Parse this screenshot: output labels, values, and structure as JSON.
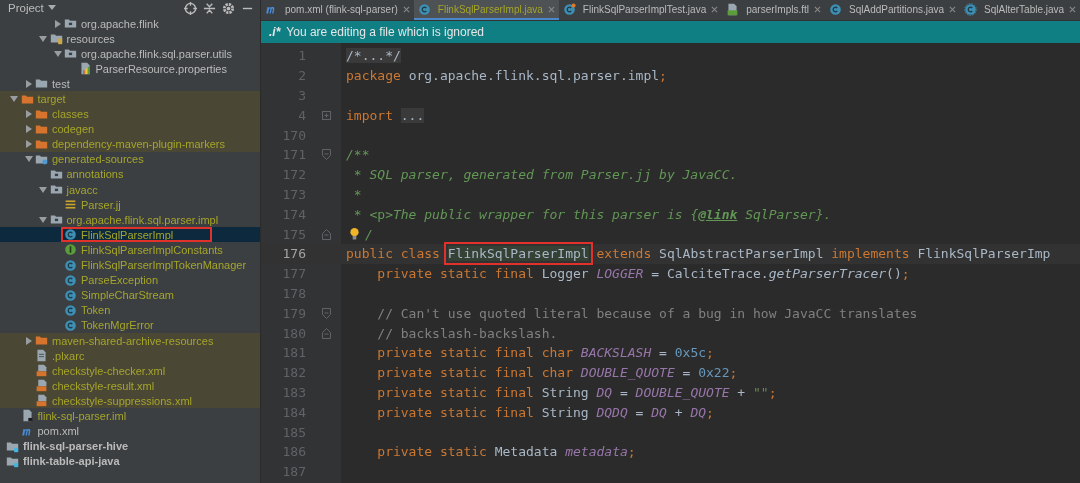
{
  "project_panel": {
    "title": "Project"
  },
  "tree": [
    {
      "children": [
        {
          "children": [
            {
              "children": [
                {
                  "children": [
                    {
                      "label": "org.apache.flink",
                      "kind": "package",
                      "expanded": false,
                      "ignored": false,
                      "excluded": false,
                      "selected": false
                    }
                  ]
                },
                {
                  "label": "resources",
                  "kind": "resources",
                  "expanded": true,
                  "ignored": false,
                  "excluded": false,
                  "selected": false,
                  "children": [
                    {
                      "label": "org.apache.flink.sql.parser.utils",
                      "kind": "package",
                      "expanded": true,
                      "ignored": false,
                      "excluded": false,
                      "selected": false,
                      "children": [
                        {
                          "label": "ParserResource.properties",
                          "kind": "properties",
                          "ignored": false,
                          "excluded": false,
                          "selected": false
                        }
                      ]
                    }
                  ]
                }
              ]
            },
            {
              "label": "test",
              "kind": "folder",
              "expanded": false,
              "ignored": false,
              "excluded": false,
              "selected": false
            }
          ]
        },
        {
          "label": "target",
          "kind": "excluded-folder",
          "expanded": true,
          "ignored": true,
          "excluded": true,
          "selected": false,
          "children": [
            {
              "label": "classes",
              "kind": "excluded-folder",
              "expanded": false,
              "ignored": true,
              "excluded": true,
              "selected": false
            },
            {
              "label": "codegen",
              "kind": "excluded-folder",
              "expanded": false,
              "ignored": true,
              "excluded": true,
              "selected": false
            },
            {
              "label": "dependency-maven-plugin-markers",
              "kind": "excluded-folder",
              "expanded": false,
              "ignored": true,
              "excluded": true,
              "selected": false
            },
            {
              "label": "generated-sources",
              "kind": "source-folder",
              "expanded": true,
              "ignored": true,
              "excluded": false,
              "selected": false,
              "children": [
                {
                  "label": "annotations",
                  "kind": "package",
                  "ignored": true,
                  "excluded": false,
                  "selected": false
                },
                {
                  "label": "javacc",
                  "kind": "package",
                  "expanded": true,
                  "ignored": true,
                  "excluded": false,
                  "selected": false,
                  "children": [
                    {
                      "label": "Parser.jj",
                      "kind": "grammar",
                      "ignored": true,
                      "excluded": false,
                      "selected": false
                    }
                  ]
                },
                {
                  "label": "org.apache.flink.sql.parser.impl",
                  "kind": "package",
                  "expanded": true,
                  "ignored": true,
                  "excluded": false,
                  "selected": false,
                  "children": [
                    {
                      "label": "FlinkSqlParserImpl",
                      "kind": "class",
                      "ignored": true,
                      "excluded": false,
                      "selected": true,
                      "highlighted": true
                    },
                    {
                      "label": "FlinkSqlParserImplConstants",
                      "kind": "interface",
                      "ignored": true,
                      "excluded": false,
                      "selected": false
                    },
                    {
                      "label": "FlinkSqlParserImplTokenManager",
                      "kind": "class",
                      "ignored": true,
                      "excluded": false,
                      "selected": false
                    },
                    {
                      "label": "ParseException",
                      "kind": "class",
                      "ignored": true,
                      "excluded": false,
                      "selected": false
                    },
                    {
                      "label": "SimpleCharStream",
                      "kind": "class",
                      "ignored": true,
                      "excluded": false,
                      "selected": false
                    },
                    {
                      "label": "Token",
                      "kind": "class",
                      "ignored": true,
                      "excluded": false,
                      "selected": false
                    },
                    {
                      "label": "TokenMgrError",
                      "kind": "class",
                      "ignored": true,
                      "excluded": false,
                      "selected": false
                    }
                  ]
                }
              ]
            },
            {
              "label": "maven-shared-archive-resources",
              "kind": "excluded-folder",
              "expanded": false,
              "ignored": true,
              "excluded": true,
              "selected": false
            },
            {
              "label": ".plxarc",
              "kind": "file",
              "ignored": true,
              "excluded": true,
              "selected": false
            },
            {
              "label": "checkstyle-checker.xml",
              "kind": "xml",
              "ignored": true,
              "excluded": true,
              "selected": false
            },
            {
              "label": "checkstyle-result.xml",
              "kind": "xml",
              "ignored": true,
              "excluded": true,
              "selected": false
            },
            {
              "label": "checkstyle-suppressions.xml",
              "kind": "xml",
              "ignored": true,
              "excluded": true,
              "selected": false
            }
          ]
        },
        {
          "label": "flink-sql-parser.iml",
          "kind": "iml",
          "ignored": true,
          "excluded": false,
          "selected": false
        },
        {
          "label": "pom.xml",
          "kind": "maven",
          "ignored": false,
          "excluded": false,
          "selected": false
        }
      ]
    },
    {
      "label": "flink-sql-parser-hive",
      "kind": "module",
      "ignored": false,
      "excluded": false,
      "selected": false
    },
    {
      "label": "flink-table-api-java",
      "kind": "module",
      "ignored": false,
      "excluded": false,
      "selected": false
    }
  ],
  "tabs": [
    {
      "label": "pom.xml (flink-sql-parser)",
      "kind": "maven",
      "selected": false,
      "ignored": false
    },
    {
      "label": "FlinkSqlParserImpl.java",
      "kind": "class",
      "selected": true,
      "ignored": true
    },
    {
      "label": "FlinkSqlParserImplTest.java",
      "kind": "test-class",
      "selected": false,
      "ignored": false
    },
    {
      "label": "parserImpls.ftl",
      "kind": "template",
      "selected": false,
      "ignored": false
    },
    {
      "label": "SqlAddPartitions.java",
      "kind": "class",
      "selected": false,
      "ignored": false
    },
    {
      "label": "SqlAlterTable.java",
      "kind": "abstract-class",
      "selected": false,
      "ignored": false
    }
  ],
  "banner": {
    "icon_text": ".i*",
    "message": "You are editing a file which is ignored"
  },
  "code": [
    {
      "number": "1",
      "current": false,
      "kind": "plain",
      "segments": [
        {
          "kind": "folded",
          "text": "/*...*/"
        }
      ]
    },
    {
      "number": "2",
      "current": false,
      "kind": "plain",
      "segments": [
        {
          "kind": "kw",
          "text": "package "
        },
        {
          "kind": "plain",
          "text": "org.apache.flink.sql.parser.impl"
        },
        {
          "kind": "kw",
          "text": ";"
        }
      ]
    },
    {
      "number": "3",
      "current": false,
      "kind": "plain"
    },
    {
      "number": "4",
      "current": false,
      "kind": "fold-collapsed",
      "segments": [
        {
          "kind": "kw",
          "text": "import "
        },
        {
          "kind": "folded",
          "text": "..."
        }
      ]
    },
    {
      "number": "170",
      "current": false,
      "kind": "plain"
    },
    {
      "number": "171",
      "current": false,
      "kind": "fold-start",
      "segments": [
        {
          "kind": "doc",
          "text": "/**"
        }
      ]
    },
    {
      "number": "172",
      "current": false,
      "kind": "plain",
      "segments": [
        {
          "kind": "doc",
          "text": " * SQL parser, generated from Parser.jj by JavaCC."
        }
      ]
    },
    {
      "number": "173",
      "current": false,
      "kind": "plain",
      "segments": [
        {
          "kind": "doc",
          "text": " *"
        }
      ]
    },
    {
      "number": "174",
      "current": false,
      "kind": "plain",
      "segments": [
        {
          "kind": "doc",
          "text": " * "
        },
        {
          "kind": "doctag",
          "text": "<p>"
        },
        {
          "kind": "doc",
          "text": "The public wrapper for this parser is {"
        },
        {
          "kind": "doclink",
          "text": "@link"
        },
        {
          "kind": "doc",
          "text": " SqlParser}."
        }
      ]
    },
    {
      "number": "175",
      "current": false,
      "kind": "fold-end",
      "bulb": true,
      "segments": [
        {
          "kind": "doc",
          "text": "/"
        }
      ]
    },
    {
      "number": "176",
      "current": true,
      "kind": "plain",
      "segments": [
        {
          "kind": "kw",
          "text": "public class "
        },
        {
          "kind": "boxed",
          "text": "FlinkSqlParserImpl"
        },
        {
          "kind": "kw",
          "text": " extends "
        },
        {
          "kind": "plain",
          "text": "SqlAbstractParserImpl "
        },
        {
          "kind": "kw",
          "text": "implements "
        },
        {
          "kind": "plain",
          "text": "FlinkSqlParserImp"
        }
      ]
    },
    {
      "number": "177",
      "current": false,
      "kind": "plain",
      "segments": [
        {
          "kind": "kw",
          "text": "    private static final "
        },
        {
          "kind": "plain",
          "text": "Logger "
        },
        {
          "kind": "field",
          "text": "LOGGER"
        },
        {
          "kind": "plain",
          "text": " = CalciteTrace."
        },
        {
          "kind": "call",
          "text": "getParserTracer"
        },
        {
          "kind": "plain",
          "text": "()"
        },
        {
          "kind": "kw",
          "text": ";"
        }
      ]
    },
    {
      "number": "178",
      "current": false,
      "kind": "plain"
    },
    {
      "number": "179",
      "current": false,
      "kind": "fold-start",
      "segments": [
        {
          "kind": "comment",
          "text": "    // Can't use quoted literal because of a bug in how JavaCC translates"
        }
      ]
    },
    {
      "number": "180",
      "current": false,
      "kind": "fold-end",
      "segments": [
        {
          "kind": "comment",
          "text": "    // backslash-backslash."
        }
      ]
    },
    {
      "number": "181",
      "current": false,
      "kind": "plain",
      "segments": [
        {
          "kind": "kw",
          "text": "    private static final char "
        },
        {
          "kind": "field",
          "text": "BACKSLASH"
        },
        {
          "kind": "plain",
          "text": " = "
        },
        {
          "kind": "num",
          "text": "0x5c"
        },
        {
          "kind": "kw",
          "text": ";"
        }
      ]
    },
    {
      "number": "182",
      "current": false,
      "kind": "plain",
      "segments": [
        {
          "kind": "kw",
          "text": "    private static final char "
        },
        {
          "kind": "field",
          "text": "DOUBLE_QUOTE"
        },
        {
          "kind": "plain",
          "text": " = "
        },
        {
          "kind": "num",
          "text": "0x22"
        },
        {
          "kind": "kw",
          "text": ";"
        }
      ]
    },
    {
      "number": "183",
      "current": false,
      "kind": "plain",
      "segments": [
        {
          "kind": "kw",
          "text": "    private static final "
        },
        {
          "kind": "plain",
          "text": "String "
        },
        {
          "kind": "field",
          "text": "DQ"
        },
        {
          "kind": "plain",
          "text": " = "
        },
        {
          "kind": "field",
          "text": "DOUBLE_QUOTE"
        },
        {
          "kind": "plain",
          "text": " + "
        },
        {
          "kind": "string",
          "text": "\"\""
        },
        {
          "kind": "kw",
          "text": ";"
        }
      ]
    },
    {
      "number": "184",
      "current": false,
      "kind": "plain",
      "segments": [
        {
          "kind": "kw",
          "text": "    private static final "
        },
        {
          "kind": "plain",
          "text": "String "
        },
        {
          "kind": "field",
          "text": "DQDQ"
        },
        {
          "kind": "plain",
          "text": " = "
        },
        {
          "kind": "field",
          "text": "DQ"
        },
        {
          "kind": "plain",
          "text": " + "
        },
        {
          "kind": "field",
          "text": "DQ"
        },
        {
          "kind": "kw",
          "text": ";"
        }
      ]
    },
    {
      "number": "185",
      "current": false,
      "kind": "plain"
    },
    {
      "number": "186",
      "current": false,
      "kind": "plain",
      "segments": [
        {
          "kind": "kw",
          "text": "    private static "
        },
        {
          "kind": "plain",
          "text": "Metadata "
        },
        {
          "kind": "field",
          "text": "metadata"
        },
        {
          "kind": "kw",
          "text": ";"
        }
      ]
    },
    {
      "number": "187",
      "current": false,
      "kind": "plain"
    }
  ]
}
